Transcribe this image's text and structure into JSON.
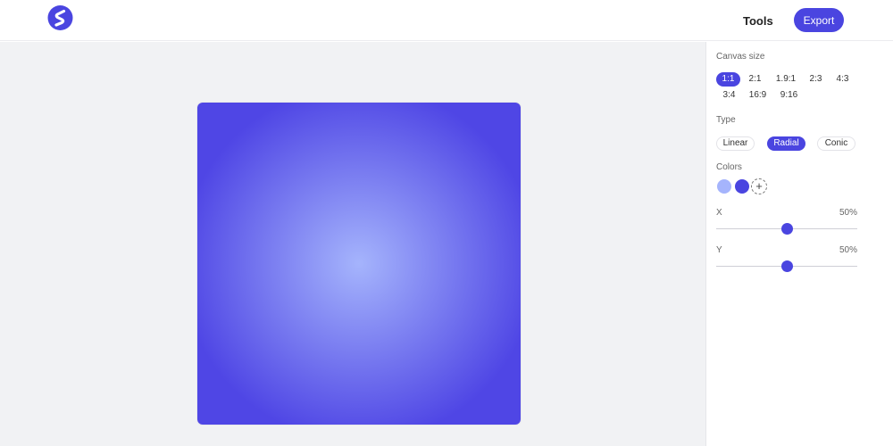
{
  "header": {
    "tools_label": "Tools",
    "export_label": "Export",
    "logo_icon": "s-logo-icon"
  },
  "canvas": {
    "gradient_type": "radial",
    "colors": [
      "#a5b4fc",
      "#4f46e5"
    ]
  },
  "panel": {
    "canvas_size": {
      "label": "Canvas size",
      "options": [
        "1:1",
        "2:1",
        "1.9:1",
        "2:3",
        "4:3",
        "3:4",
        "16:9",
        "9:16"
      ],
      "selected": "1:1"
    },
    "type": {
      "label": "Type",
      "options": [
        "Linear",
        "Radial",
        "Conic"
      ],
      "selected": "Radial"
    },
    "colors": {
      "label": "Colors",
      "swatches": [
        "#a5b4fc",
        "#4a45e0"
      ],
      "add_icon": "plus-icon",
      "add_label": "+"
    },
    "x": {
      "label": "X",
      "value_text": "50%",
      "value": 50
    },
    "y": {
      "label": "Y",
      "value_text": "50%",
      "value": 50
    }
  },
  "colors": {
    "accent": "#4a45e0",
    "workspace_bg": "#f1f2f4"
  }
}
